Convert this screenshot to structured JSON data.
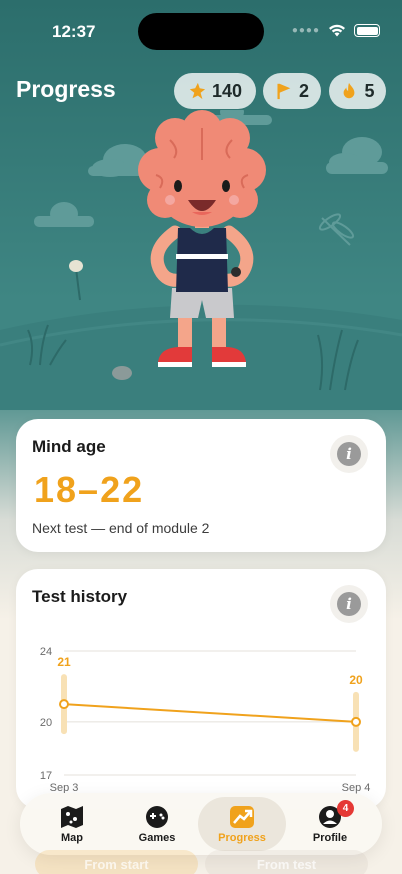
{
  "status": {
    "time": "12:37"
  },
  "header": {
    "title": "Progress",
    "stats": {
      "points": "140",
      "flags": "2",
      "streak": "5"
    }
  },
  "mind_age": {
    "title": "Mind age",
    "value": "18–22",
    "subtitle": "Next test — end of module 2"
  },
  "test_history": {
    "title": "Test history",
    "chart_data": {
      "type": "line",
      "categories": [
        "Sep 3",
        "Sep 4"
      ],
      "values": [
        21,
        20
      ],
      "data_labels": [
        "21",
        "20"
      ],
      "y_ticks": [
        "24",
        "20",
        "17"
      ],
      "ylim": [
        17,
        24
      ]
    }
  },
  "tabs": [
    {
      "label": "Map"
    },
    {
      "label": "Games"
    },
    {
      "label": "Progress"
    },
    {
      "label": "Profile",
      "badge": "4"
    }
  ],
  "bottom_buttons": {
    "from_start": "From start",
    "from_test": "From test"
  },
  "colors": {
    "accent": "#f0a21c",
    "teal": "#3f8683",
    "badge": "#e53935"
  }
}
